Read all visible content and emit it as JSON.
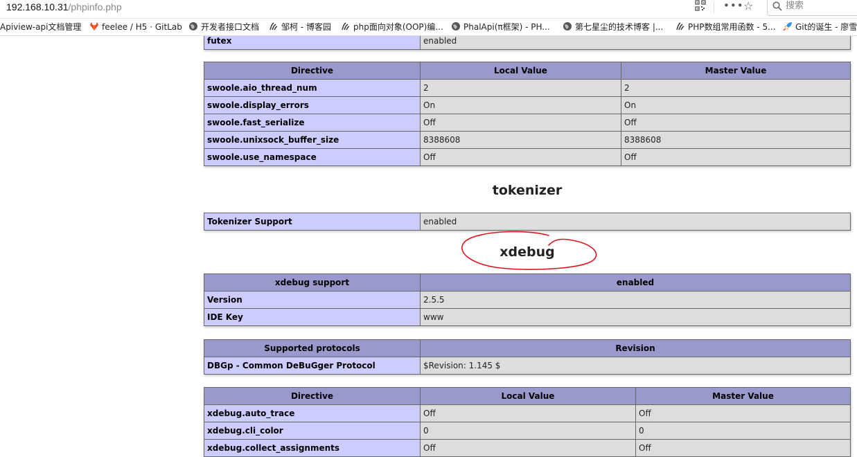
{
  "browser": {
    "url_host": "192.168.10.31",
    "url_path": "/phpinfo.php",
    "search_placeholder": "搜索",
    "more_glyph": "•••",
    "star_glyph": "☆",
    "bookmarks": [
      {
        "label": "Apiview-api文档管理",
        "icon": "none"
      },
      {
        "label": "feelee / H5 · GitLab",
        "icon": "gitlab-icon"
      },
      {
        "label": "开发者接口文档",
        "icon": "globe-icon"
      },
      {
        "label": "邹柯 - 博客园",
        "icon": "cnblogs-icon"
      },
      {
        "label": "php面向对象(OOP)编...",
        "icon": "cnblogs-icon"
      },
      {
        "label": "PhalApi(π框架) - PH...",
        "icon": "globe-icon"
      },
      {
        "label": "第七星尘的技术博客 |...",
        "icon": "globe-icon"
      },
      {
        "label": "PHP数组常用函数 - 5...",
        "icon": "cnblogs-icon"
      },
      {
        "label": "Git的诞生 - 廖雪",
        "icon": "rocket-icon"
      }
    ]
  },
  "futex_table": {
    "rows": [
      [
        "futex",
        "enabled"
      ]
    ]
  },
  "swoole_table": {
    "headers": [
      "Directive",
      "Local Value",
      "Master Value"
    ],
    "rows": [
      [
        "swoole.aio_thread_num",
        "2",
        "2"
      ],
      [
        "swoole.display_errors",
        "On",
        "On"
      ],
      [
        "swoole.fast_serialize",
        "Off",
        "Off"
      ],
      [
        "swoole.unixsock_buffer_size",
        "8388608",
        "8388608"
      ],
      [
        "swoole.use_namespace",
        "Off",
        "Off"
      ]
    ]
  },
  "tokenizer": {
    "heading": "tokenizer",
    "rows": [
      [
        "Tokenizer Support",
        "enabled"
      ]
    ]
  },
  "xdebug": {
    "heading": "xdebug",
    "annotation_color": "#e0141e",
    "support_table": {
      "headers": [
        "xdebug support",
        "enabled"
      ],
      "rows": [
        [
          "Version",
          "2.5.5"
        ],
        [
          "IDE Key",
          "www"
        ]
      ]
    },
    "protocols_table": {
      "headers": [
        "Supported protocols",
        "Revision"
      ],
      "rows": [
        [
          "DBGp - Common DeBuGger Protocol",
          "$Revision: 1.145 $"
        ]
      ]
    },
    "directives_table": {
      "headers": [
        "Directive",
        "Local Value",
        "Master Value"
      ],
      "rows": [
        [
          "xdebug.auto_trace",
          "Off",
          "Off"
        ],
        [
          "xdebug.cli_color",
          "0",
          "0"
        ],
        [
          "xdebug.collect_assignments",
          "Off",
          "Off"
        ]
      ]
    }
  },
  "colors": {
    "header_bg": "#9999cc",
    "key_bg": "#ccccff",
    "value_bg": "#dddddd"
  }
}
